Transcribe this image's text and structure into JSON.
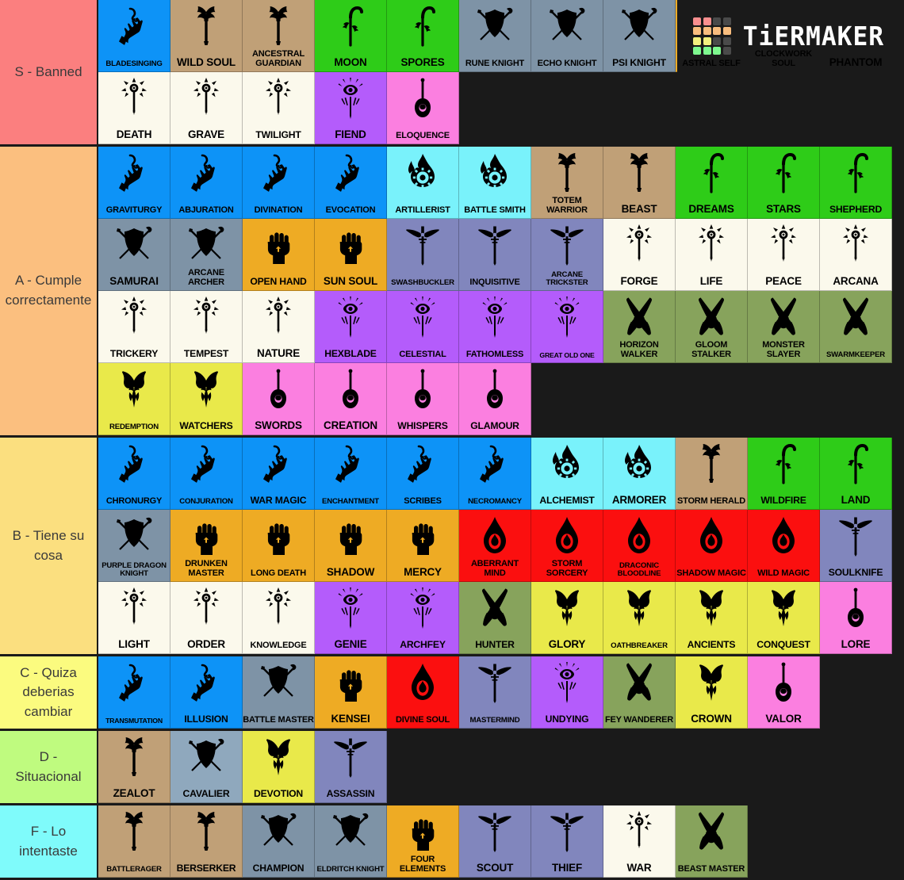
{
  "logo": {
    "text": "TiERMAKER",
    "swatches": [
      "#f98f8f",
      "#f98f8f",
      "#4a4a4a",
      "#4a4a4a",
      "#f9bd7e",
      "#f9bd7e",
      "#f9bd7e",
      "#f9bd7e",
      "#f2f07e",
      "#f2f07e",
      "#4a4a4a",
      "#4a4a4a",
      "#7ef98f",
      "#7ef98f",
      "#7ef98f",
      "#4a4a4a"
    ]
  },
  "palette": {
    "wizard": "#0d93f7",
    "barbarian": "#c0a077",
    "druid": "#2ecc18",
    "fighter": "#7e93a6",
    "monk": "#eeab24",
    "sorcerer": "#fb0f0f",
    "rogue": "#8186bd",
    "cleric": "#fbf9ec",
    "warlock": "#b45cfb",
    "bard": "#fb7fe0",
    "artificer": "#79f2fb",
    "paladin": "#e9e94a",
    "ranger": "#87a35c",
    "fighter_light": "#8fa8bd",
    "tier_s": "#fb7f7f",
    "tier_a": "#fbbf7f",
    "tier_b": "#fbdf7f",
    "tier_c": "#fbfb7f",
    "tier_d": "#bffb7f",
    "tier_f": "#7ffbfb",
    "background": "#1a1a1a"
  },
  "tiers": [
    {
      "label": "S - Banned",
      "color": "#fb7f7f",
      "items": [
        {
          "name": "BLADESINGING",
          "color": "#0d93f7",
          "icon": "wizard-hand-icon",
          "size": "f10"
        },
        {
          "name": "WILD SOUL",
          "color": "#c0a077",
          "icon": "barbarian-axe-icon",
          "size": "f13"
        },
        {
          "name": "ANCESTRAL GUARDIAN",
          "color": "#c0a077",
          "icon": "barbarian-axe-icon",
          "size": "f11"
        },
        {
          "name": "MOON",
          "color": "#2ecc18",
          "icon": "druid-sickle-icon",
          "size": "f13"
        },
        {
          "name": "SPORES",
          "color": "#2ecc18",
          "icon": "druid-sickle-icon",
          "size": "f13"
        },
        {
          "name": "RUNE KNIGHT",
          "color": "#7e93a6",
          "icon": "fighter-shield-icon",
          "size": "f11"
        },
        {
          "name": "ECHO KNIGHT",
          "color": "#7e93a6",
          "icon": "fighter-shield-icon",
          "size": "f11"
        },
        {
          "name": "PSI KNIGHT",
          "color": "#7e93a6",
          "icon": "fighter-shield-icon",
          "size": "f12"
        },
        {
          "name": "ASTRAL SELF",
          "color": "#eeab24",
          "icon": "monk-fist-icon",
          "size": "f11"
        },
        {
          "name": "CLOCKWORK SOUL",
          "color": "#fb0f0f",
          "icon": "sorcerer-flame-icon",
          "size": "f11"
        },
        {
          "name": "PHANTOM",
          "color": "#8186bd",
          "icon": "rogue-dagger-icon",
          "size": "f13"
        },
        {
          "name": "DEATH",
          "color": "#fbf9ec",
          "icon": "cleric-mace-icon",
          "size": "f13"
        },
        {
          "name": "GRAVE",
          "color": "#fbf9ec",
          "icon": "cleric-mace-icon",
          "size": "f13"
        },
        {
          "name": "TWILIGHT",
          "color": "#fbf9ec",
          "icon": "cleric-mace-icon",
          "size": "f12"
        },
        {
          "name": "FIEND",
          "color": "#b45cfb",
          "icon": "warlock-eye-icon",
          "size": "f13"
        },
        {
          "name": "ELOQUENCE",
          "color": "#fb7fe0",
          "icon": "bard-lute-icon",
          "size": "f11"
        }
      ]
    },
    {
      "label": "A - Cumple correctamente",
      "color": "#fbbf7f",
      "items": [
        {
          "name": "GRAVITURGY",
          "color": "#0d93f7",
          "icon": "wizard-hand-icon",
          "size": "f11"
        },
        {
          "name": "ABJURATION",
          "color": "#0d93f7",
          "icon": "wizard-hand-icon",
          "size": "f11"
        },
        {
          "name": "DIVINATION",
          "color": "#0d93f7",
          "icon": "wizard-hand-icon",
          "size": "f11"
        },
        {
          "name": "EVOCATION",
          "color": "#0d93f7",
          "icon": "wizard-hand-icon",
          "size": "f11"
        },
        {
          "name": "ARTILLERIST",
          "color": "#79f2fb",
          "icon": "artificer-gear-icon",
          "size": "f11"
        },
        {
          "name": "BATTLE SMITH",
          "color": "#79f2fb",
          "icon": "artificer-gear-icon",
          "size": "f11"
        },
        {
          "name": "TOTEM WARRIOR",
          "color": "#c0a077",
          "icon": "barbarian-axe-icon",
          "size": "f11"
        },
        {
          "name": "BEAST",
          "color": "#c0a077",
          "icon": "barbarian-axe-icon",
          "size": "f13"
        },
        {
          "name": "DREAMS",
          "color": "#2ecc18",
          "icon": "druid-sickle-icon",
          "size": "f13"
        },
        {
          "name": "STARS",
          "color": "#2ecc18",
          "icon": "druid-sickle-icon",
          "size": "f13"
        },
        {
          "name": "SHEPHERD",
          "color": "#2ecc18",
          "icon": "druid-sickle-icon",
          "size": "f12"
        },
        {
          "name": "SAMURAI",
          "color": "#7e93a6",
          "icon": "fighter-shield-icon",
          "size": "f13"
        },
        {
          "name": "ARCANE ARCHER",
          "color": "#7e93a6",
          "icon": "fighter-shield-icon",
          "size": "f11"
        },
        {
          "name": "OPEN HAND",
          "color": "#eeab24",
          "icon": "monk-fist-icon",
          "size": "f12"
        },
        {
          "name": "SUN SOUL",
          "color": "#eeab24",
          "icon": "monk-fist-icon",
          "size": "f13"
        },
        {
          "name": "SWASHBUCKLER",
          "color": "#8186bd",
          "icon": "rogue-dagger-icon",
          "size": "f10"
        },
        {
          "name": "INQUISITIVE",
          "color": "#8186bd",
          "icon": "rogue-dagger-icon",
          "size": "f11"
        },
        {
          "name": "ARCANE TRICKSTER",
          "color": "#8186bd",
          "icon": "rogue-dagger-icon",
          "size": "f10"
        },
        {
          "name": "FORGE",
          "color": "#fbf9ec",
          "icon": "cleric-mace-icon",
          "size": "f13"
        },
        {
          "name": "LIFE",
          "color": "#fbf9ec",
          "icon": "cleric-mace-icon",
          "size": "f13"
        },
        {
          "name": "PEACE",
          "color": "#fbf9ec",
          "icon": "cleric-mace-icon",
          "size": "f13"
        },
        {
          "name": "ARCANA",
          "color": "#fbf9ec",
          "icon": "cleric-mace-icon",
          "size": "f13"
        },
        {
          "name": "TRICKERY",
          "color": "#fbf9ec",
          "icon": "cleric-mace-icon",
          "size": "f12"
        },
        {
          "name": "TEMPEST",
          "color": "#fbf9ec",
          "icon": "cleric-mace-icon",
          "size": "f12"
        },
        {
          "name": "NATURE",
          "color": "#fbf9ec",
          "icon": "cleric-mace-icon",
          "size": "f13"
        },
        {
          "name": "HEXBLADE",
          "color": "#b45cfb",
          "icon": "warlock-eye-icon",
          "size": "f12"
        },
        {
          "name": "CELESTIAL",
          "color": "#b45cfb",
          "icon": "warlock-eye-icon",
          "size": "f11"
        },
        {
          "name": "FATHOMLESS",
          "color": "#b45cfb",
          "icon": "warlock-eye-icon",
          "size": "f11"
        },
        {
          "name": "GREAT OLD ONE",
          "color": "#b45cfb",
          "icon": "warlock-eye-icon",
          "size": "f9"
        },
        {
          "name": "HORIZON WALKER",
          "color": "#87a35c",
          "icon": "ranger-arrows-icon",
          "size": "f11"
        },
        {
          "name": "GLOOM STALKER",
          "color": "#87a35c",
          "icon": "ranger-arrows-icon",
          "size": "f11"
        },
        {
          "name": "MONSTER SLAYER",
          "color": "#87a35c",
          "icon": "ranger-arrows-icon",
          "size": "f11"
        },
        {
          "name": "SWARMKEEPER",
          "color": "#87a35c",
          "icon": "ranger-arrows-icon",
          "size": "f10"
        },
        {
          "name": "REDEMPTION",
          "color": "#e9e94a",
          "icon": "paladin-helm-icon",
          "size": "f10"
        },
        {
          "name": "WATCHERS",
          "color": "#e9e94a",
          "icon": "paladin-helm-icon",
          "size": "f12"
        },
        {
          "name": "SWORDS",
          "color": "#fb7fe0",
          "icon": "bard-lute-icon",
          "size": "f13"
        },
        {
          "name": "CREATION",
          "color": "#fb7fe0",
          "icon": "bard-lute-icon",
          "size": "f13"
        },
        {
          "name": "WHISPERS",
          "color": "#fb7fe0",
          "icon": "bard-lute-icon",
          "size": "f12"
        },
        {
          "name": "GLAMOUR",
          "color": "#fb7fe0",
          "icon": "bard-lute-icon",
          "size": "f12"
        }
      ]
    },
    {
      "label": "B - Tiene su cosa",
      "color": "#fbdf7f",
      "items": [
        {
          "name": "CHRONURGY",
          "color": "#0d93f7",
          "icon": "wizard-hand-icon",
          "size": "f11"
        },
        {
          "name": "CONJURATION",
          "color": "#0d93f7",
          "icon": "wizard-hand-icon",
          "size": "f10"
        },
        {
          "name": "WAR MAGIC",
          "color": "#0d93f7",
          "icon": "wizard-hand-icon",
          "size": "f12"
        },
        {
          "name": "ENCHANTMENT",
          "color": "#0d93f7",
          "icon": "wizard-hand-icon",
          "size": "f10"
        },
        {
          "name": "SCRIBES",
          "color": "#0d93f7",
          "icon": "wizard-hand-icon",
          "size": "f11"
        },
        {
          "name": "NECROMANCY",
          "color": "#0d93f7",
          "icon": "wizard-hand-icon",
          "size": "f10"
        },
        {
          "name": "ALCHEMIST",
          "color": "#79f2fb",
          "icon": "artificer-gear-icon",
          "size": "f12"
        },
        {
          "name": "ARMORER",
          "color": "#79f2fb",
          "icon": "artificer-gear-icon",
          "size": "f13"
        },
        {
          "name": "STORM HERALD",
          "color": "#c0a077",
          "icon": "barbarian-axe-icon",
          "size": "f11"
        },
        {
          "name": "WILDFIRE",
          "color": "#2ecc18",
          "icon": "druid-sickle-icon",
          "size": "f12"
        },
        {
          "name": "LAND",
          "color": "#2ecc18",
          "icon": "druid-sickle-icon",
          "size": "f13"
        },
        {
          "name": "PURPLE DRAGON KNIGHT",
          "color": "#7e93a6",
          "icon": "fighter-shield-icon",
          "size": "f10"
        },
        {
          "name": "DRUNKEN MASTER",
          "color": "#eeab24",
          "icon": "monk-fist-icon",
          "size": "f11"
        },
        {
          "name": "LONG DEATH",
          "color": "#eeab24",
          "icon": "monk-fist-icon",
          "size": "f11"
        },
        {
          "name": "SHADOW",
          "color": "#eeab24",
          "icon": "monk-fist-icon",
          "size": "f13"
        },
        {
          "name": "MERCY",
          "color": "#eeab24",
          "icon": "monk-fist-icon",
          "size": "f13"
        },
        {
          "name": "ABERRANT MIND",
          "color": "#fb0f0f",
          "icon": "sorcerer-flame-icon",
          "size": "f11"
        },
        {
          "name": "STORM SORCERY",
          "color": "#fb0f0f",
          "icon": "sorcerer-flame-icon",
          "size": "f11"
        },
        {
          "name": "DRACONIC BLOODLINE",
          "color": "#fb0f0f",
          "icon": "sorcerer-flame-icon",
          "size": "f10"
        },
        {
          "name": "SHADOW MAGIC",
          "color": "#fb0f0f",
          "icon": "sorcerer-flame-icon",
          "size": "f11"
        },
        {
          "name": "WILD MAGIC",
          "color": "#fb0f0f",
          "icon": "sorcerer-flame-icon",
          "size": "f11"
        },
        {
          "name": "SOULKNIFE",
          "color": "#8186bd",
          "icon": "rogue-dagger-icon",
          "size": "f12"
        },
        {
          "name": "LIGHT",
          "color": "#fbf9ec",
          "icon": "cleric-mace-icon",
          "size": "f13"
        },
        {
          "name": "ORDER",
          "color": "#fbf9ec",
          "icon": "cleric-mace-icon",
          "size": "f13"
        },
        {
          "name": "KNOWLEDGE",
          "color": "#fbf9ec",
          "icon": "cleric-mace-icon",
          "size": "f11"
        },
        {
          "name": "GENIE",
          "color": "#b45cfb",
          "icon": "warlock-eye-icon",
          "size": "f13"
        },
        {
          "name": "ARCHFEY",
          "color": "#b45cfb",
          "icon": "warlock-eye-icon",
          "size": "f12"
        },
        {
          "name": "HUNTER",
          "color": "#87a35c",
          "icon": "ranger-arrows-icon",
          "size": "f12"
        },
        {
          "name": "GLORY",
          "color": "#e9e94a",
          "icon": "paladin-helm-icon",
          "size": "f13"
        },
        {
          "name": "OATHBREAKER",
          "color": "#e9e94a",
          "icon": "paladin-helm-icon",
          "size": "f10"
        },
        {
          "name": "ANCIENTS",
          "color": "#e9e94a",
          "icon": "paladin-helm-icon",
          "size": "f12"
        },
        {
          "name": "CONQUEST",
          "color": "#e9e94a",
          "icon": "paladin-helm-icon",
          "size": "f12"
        },
        {
          "name": "LORE",
          "color": "#fb7fe0",
          "icon": "bard-lute-icon",
          "size": "f13"
        }
      ]
    },
    {
      "label": "C - Quiza deberias cambiar",
      "color": "#fbfb7f",
      "items": [
        {
          "name": "TRANSMUTATION",
          "color": "#0d93f7",
          "icon": "wizard-hand-icon",
          "size": "f9"
        },
        {
          "name": "ILLUSION",
          "color": "#0d93f7",
          "icon": "wizard-hand-icon",
          "size": "f12"
        },
        {
          "name": "BATTLE MASTER",
          "color": "#7e93a6",
          "icon": "fighter-shield-icon",
          "size": "f11"
        },
        {
          "name": "KENSEI",
          "color": "#eeab24",
          "icon": "monk-fist-icon",
          "size": "f13"
        },
        {
          "name": "DIVINE SOUL",
          "color": "#fb0f0f",
          "icon": "sorcerer-flame-icon",
          "size": "f11"
        },
        {
          "name": "MASTERMIND",
          "color": "#8186bd",
          "icon": "rogue-dagger-icon",
          "size": "f10"
        },
        {
          "name": "UNDYING",
          "color": "#b45cfb",
          "icon": "warlock-eye-icon",
          "size": "f12"
        },
        {
          "name": "FEY WANDERER",
          "color": "#87a35c",
          "icon": "ranger-arrows-icon",
          "size": "f11"
        },
        {
          "name": "CROWN",
          "color": "#e9e94a",
          "icon": "paladin-helm-icon",
          "size": "f13"
        },
        {
          "name": "VALOR",
          "color": "#fb7fe0",
          "icon": "bard-lute-icon",
          "size": "f13"
        }
      ]
    },
    {
      "label": "D - Situacional",
      "color": "#bffb7f",
      "items": [
        {
          "name": "ZEALOT",
          "color": "#c0a077",
          "icon": "barbarian-axe-icon",
          "size": "f13"
        },
        {
          "name": "CAVALIER",
          "color": "#8fa8bd",
          "icon": "fighter-shield-icon",
          "size": "f12"
        },
        {
          "name": "DEVOTION",
          "color": "#e9e94a",
          "icon": "paladin-helm-icon",
          "size": "f12"
        },
        {
          "name": "ASSASSIN",
          "color": "#8186bd",
          "icon": "rogue-dagger-icon",
          "size": "f12"
        }
      ]
    },
    {
      "label": "F - Lo intentaste",
      "color": "#7ffbfb",
      "items": [
        {
          "name": "BATTLERAGER",
          "color": "#c0a077",
          "icon": "barbarian-axe-icon",
          "size": "f10"
        },
        {
          "name": "BERSERKER",
          "color": "#c0a077",
          "icon": "barbarian-axe-icon",
          "size": "f12"
        },
        {
          "name": "CHAMPION",
          "color": "#7e93a6",
          "icon": "fighter-shield-icon",
          "size": "f12"
        },
        {
          "name": "ELDRITCH KNIGHT",
          "color": "#7e93a6",
          "icon": "fighter-shield-icon",
          "size": "f10"
        },
        {
          "name": "FOUR ELEMENTS",
          "color": "#eeab24",
          "icon": "monk-fist-icon",
          "size": "f11"
        },
        {
          "name": "SCOUT",
          "color": "#8186bd",
          "icon": "rogue-dagger-icon",
          "size": "f13"
        },
        {
          "name": "THIEF",
          "color": "#8186bd",
          "icon": "rogue-dagger-icon",
          "size": "f13"
        },
        {
          "name": "WAR",
          "color": "#fbf9ec",
          "icon": "cleric-mace-icon",
          "size": "f13"
        },
        {
          "name": "BEAST MASTER",
          "color": "#87a35c",
          "icon": "ranger-arrows-icon",
          "size": "f11"
        }
      ]
    }
  ]
}
